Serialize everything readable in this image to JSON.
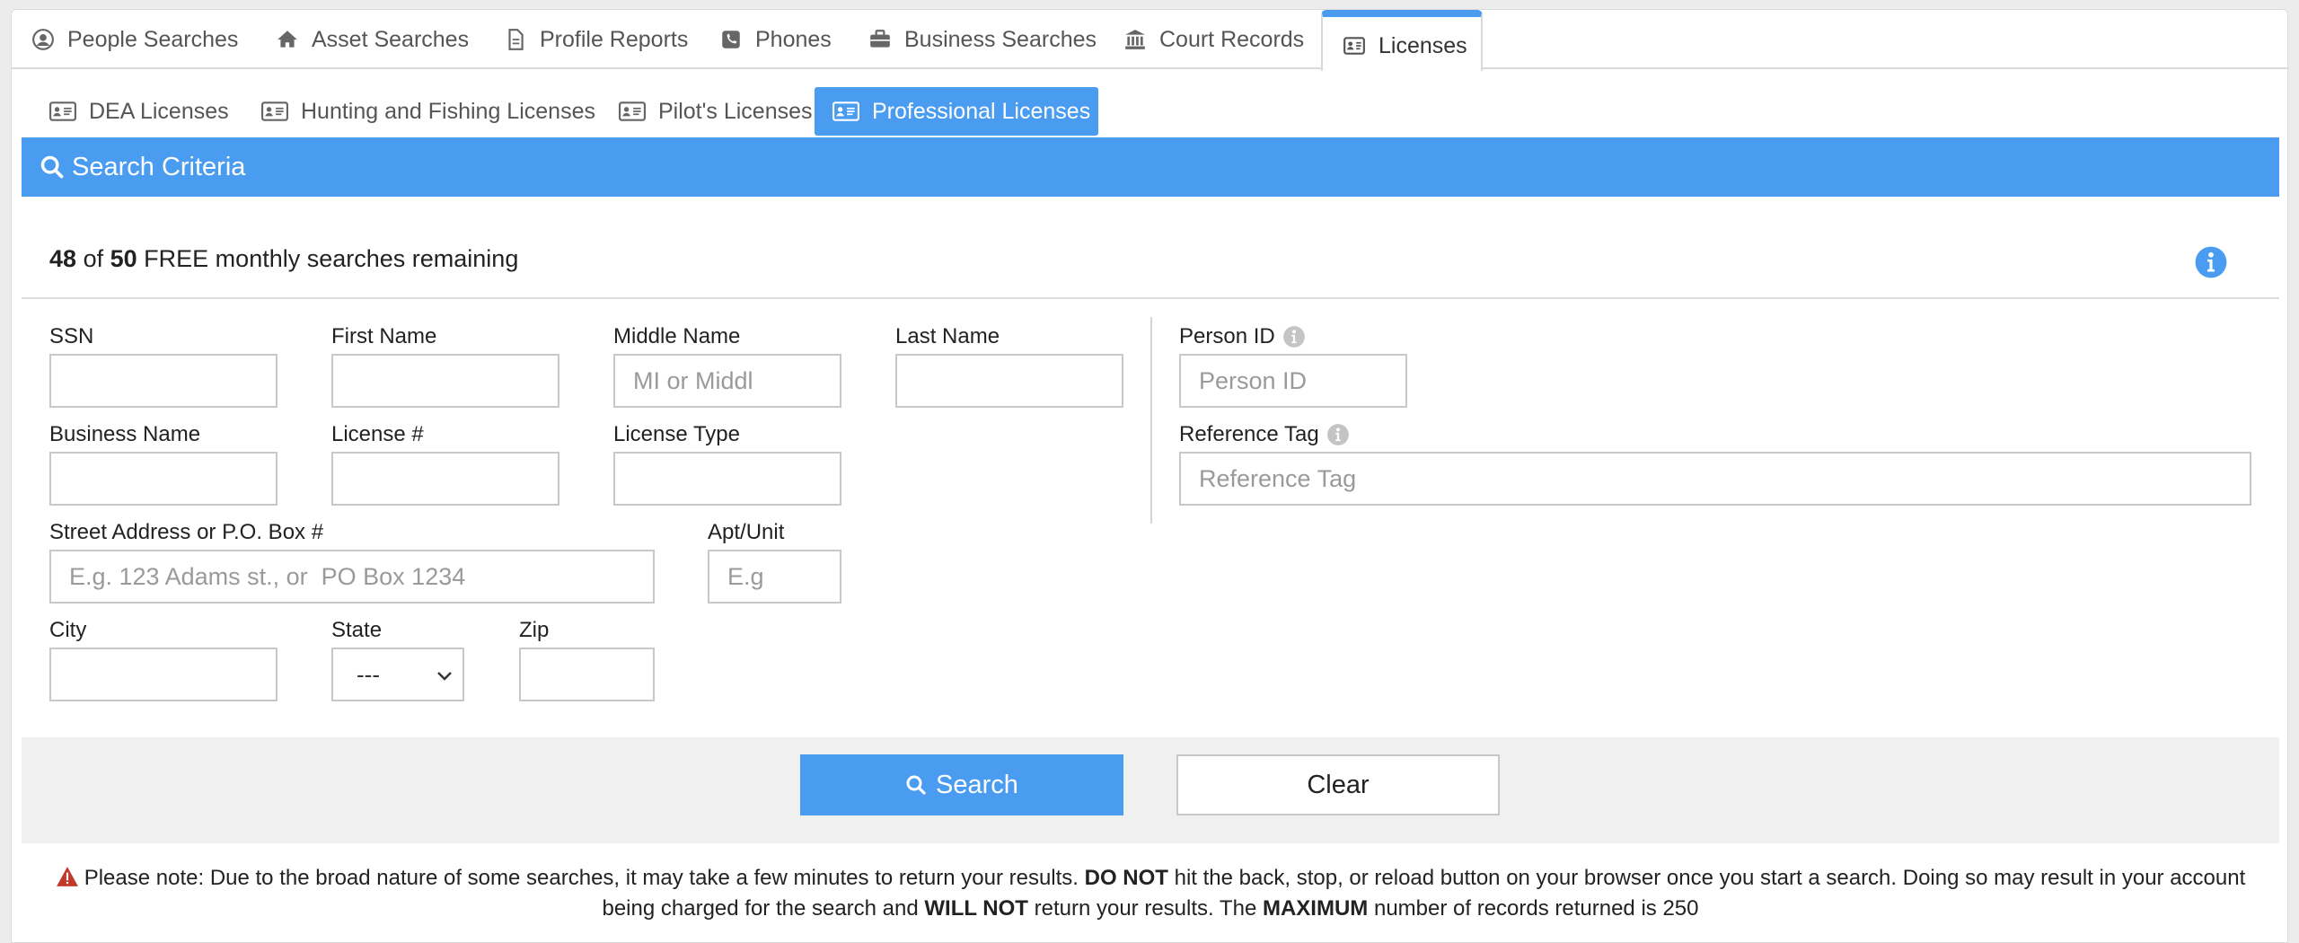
{
  "top_tabs": [
    {
      "label": "People Searches",
      "icon": "user-circle-icon"
    },
    {
      "label": "Asset Searches",
      "icon": "home-icon"
    },
    {
      "label": "Profile Reports",
      "icon": "document-icon"
    },
    {
      "label": "Phones",
      "icon": "phone-icon"
    },
    {
      "label": "Business Searches",
      "icon": "briefcase-icon"
    },
    {
      "label": "Court Records",
      "icon": "courthouse-icon"
    },
    {
      "label": "Licenses",
      "icon": "id-card-icon",
      "active": true
    }
  ],
  "sub_tabs": [
    {
      "label": "DEA Licenses"
    },
    {
      "label": "Hunting and Fishing Licenses"
    },
    {
      "label": "Pilot's Licenses"
    },
    {
      "label": "Professional Licenses",
      "active": true
    }
  ],
  "criteria": {
    "title": "Search Criteria"
  },
  "remaining": {
    "used": "48",
    "of": "of",
    "total": "50",
    "text": "FREE monthly searches remaining"
  },
  "fields": {
    "ssn": {
      "label": "SSN",
      "value": "",
      "placeholder": ""
    },
    "first_name": {
      "label": "First Name",
      "value": "",
      "placeholder": ""
    },
    "middle_name": {
      "label": "Middle Name",
      "value": "",
      "placeholder": "MI or Middl"
    },
    "last_name": {
      "label": "Last Name",
      "value": "",
      "placeholder": ""
    },
    "person_id": {
      "label": "Person ID",
      "value": "",
      "placeholder": "Person ID"
    },
    "business_name": {
      "label": "Business Name",
      "value": "",
      "placeholder": ""
    },
    "license_no": {
      "label": "License #",
      "value": "",
      "placeholder": ""
    },
    "license_type": {
      "label": "License Type",
      "value": "",
      "placeholder": ""
    },
    "reference_tag": {
      "label": "Reference Tag",
      "value": "",
      "placeholder": "Reference Tag"
    },
    "street": {
      "label": "Street Address or P.O. Box #",
      "value": "",
      "placeholder": "E.g. 123 Adams st., or  PO Box 1234"
    },
    "apt": {
      "label": "Apt/Unit",
      "value": "",
      "placeholder": "E.g"
    },
    "city": {
      "label": "City",
      "value": "",
      "placeholder": ""
    },
    "state": {
      "label": "State",
      "selected": "---"
    },
    "zip": {
      "label": "Zip",
      "value": "",
      "placeholder": ""
    }
  },
  "buttons": {
    "search": "Search",
    "clear": "Clear"
  },
  "note": {
    "part1": "Please note: Due to the broad nature of some searches, it may take a few minutes to return your results.",
    "strong1": "DO NOT",
    "part2": "hit the back, stop, or reload button on your browser once you start a search. Doing so may result in your account being charged for the search and",
    "strong2": "WILL NOT",
    "part3": "return your results. The",
    "strong3": "MAXIMUM",
    "part4": "number of records returned is 250"
  },
  "colors": {
    "accent": "#4a9cf0",
    "warning": "#c0392b"
  }
}
